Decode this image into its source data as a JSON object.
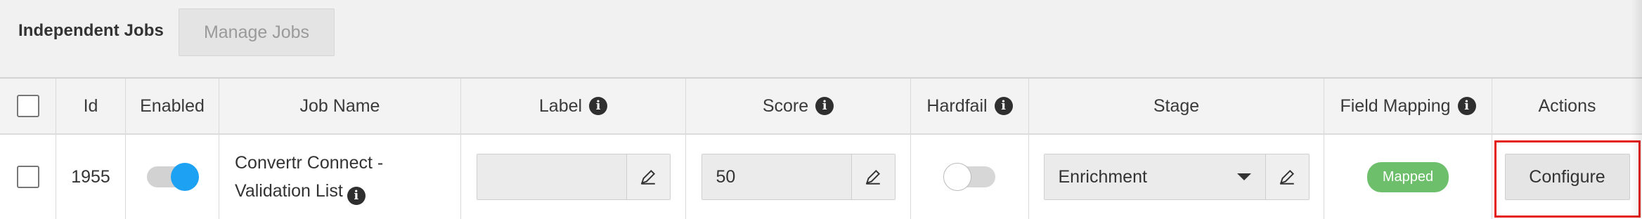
{
  "header": {
    "title": "Independent Jobs",
    "manage_button": "Manage Jobs"
  },
  "table": {
    "columns": {
      "id": "Id",
      "enabled": "Enabled",
      "job_name": "Job Name",
      "label": "Label",
      "score": "Score",
      "hardfail": "Hardfail",
      "stage": "Stage",
      "field_mapping": "Field Mapping",
      "actions": "Actions"
    },
    "row": {
      "id": "1955",
      "enabled": true,
      "job_name_line1": "Convertr Connect -",
      "job_name_line2": "Validation List",
      "label_value": "",
      "score_value": "50",
      "hardfail": false,
      "stage_value": "Enrichment",
      "field_mapping_status": "Mapped",
      "action_button": "Configure"
    }
  },
  "icons": {
    "info": "info-circle-icon",
    "edit": "pencil-icon",
    "dropdown": "caret-down-icon"
  },
  "colors": {
    "toggle_on": "#1da1f2",
    "mapped_badge": "#6dbf6b",
    "highlight": "#e41b17"
  }
}
